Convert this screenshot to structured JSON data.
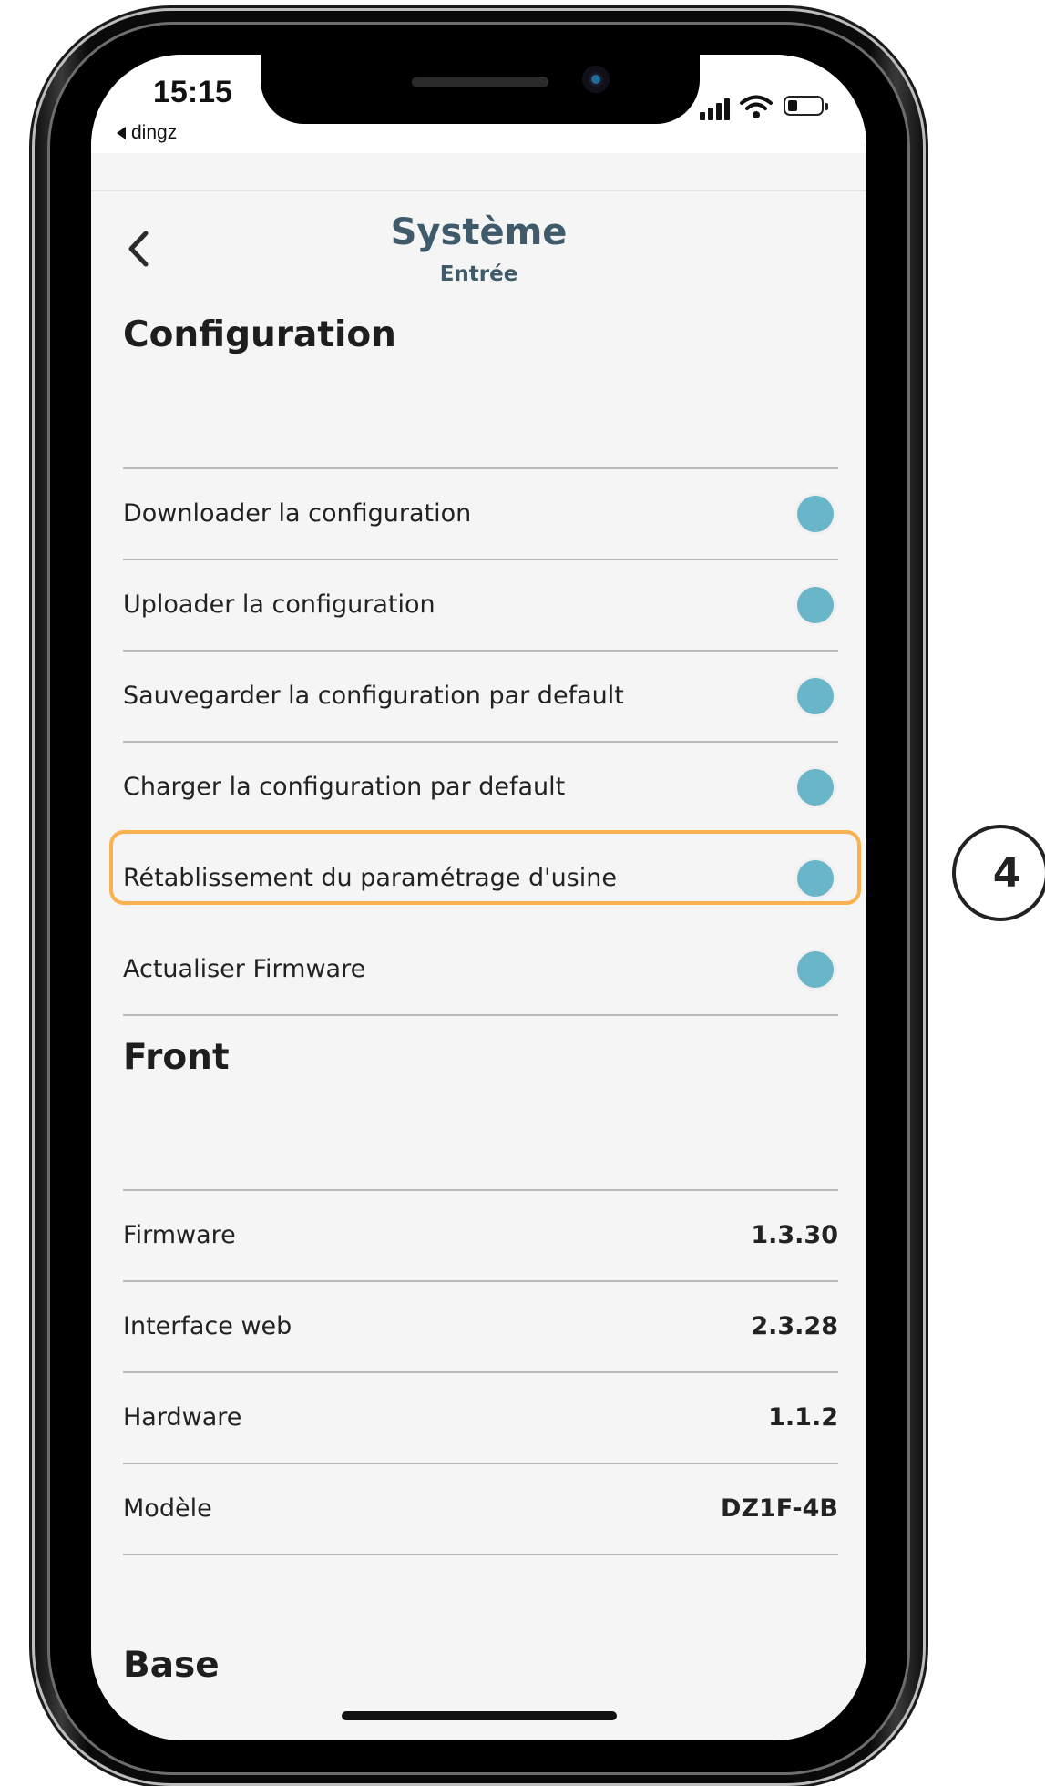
{
  "status_bar": {
    "time": "15:15",
    "back_app": "dingz"
  },
  "nav": {
    "title": "Système",
    "subtitle": "Entrée"
  },
  "configuration": {
    "title": "Configuration",
    "items": [
      {
        "label": "Downloader la configuration"
      },
      {
        "label": "Uploader la configuration"
      },
      {
        "label": "Sauvegarder la configuration par default"
      },
      {
        "label": "Charger la configuration par default"
      },
      {
        "label": "Rétablissement du paramétrage d'usine"
      },
      {
        "label": "Actualiser Firmware"
      }
    ]
  },
  "front": {
    "title": "Front",
    "rows": [
      {
        "label": "Firmware",
        "value": "1.3.30"
      },
      {
        "label": "Interface web",
        "value": "2.3.28"
      },
      {
        "label": "Hardware",
        "value": "1.1.2"
      },
      {
        "label": "Modèle",
        "value": "DZ1F-4B"
      }
    ]
  },
  "base": {
    "title": "Base"
  },
  "step_badge": "4",
  "colors": {
    "accent_dot": "#6ab6c9",
    "highlight": "#f9b24d",
    "title_color": "#3f5a6a"
  }
}
